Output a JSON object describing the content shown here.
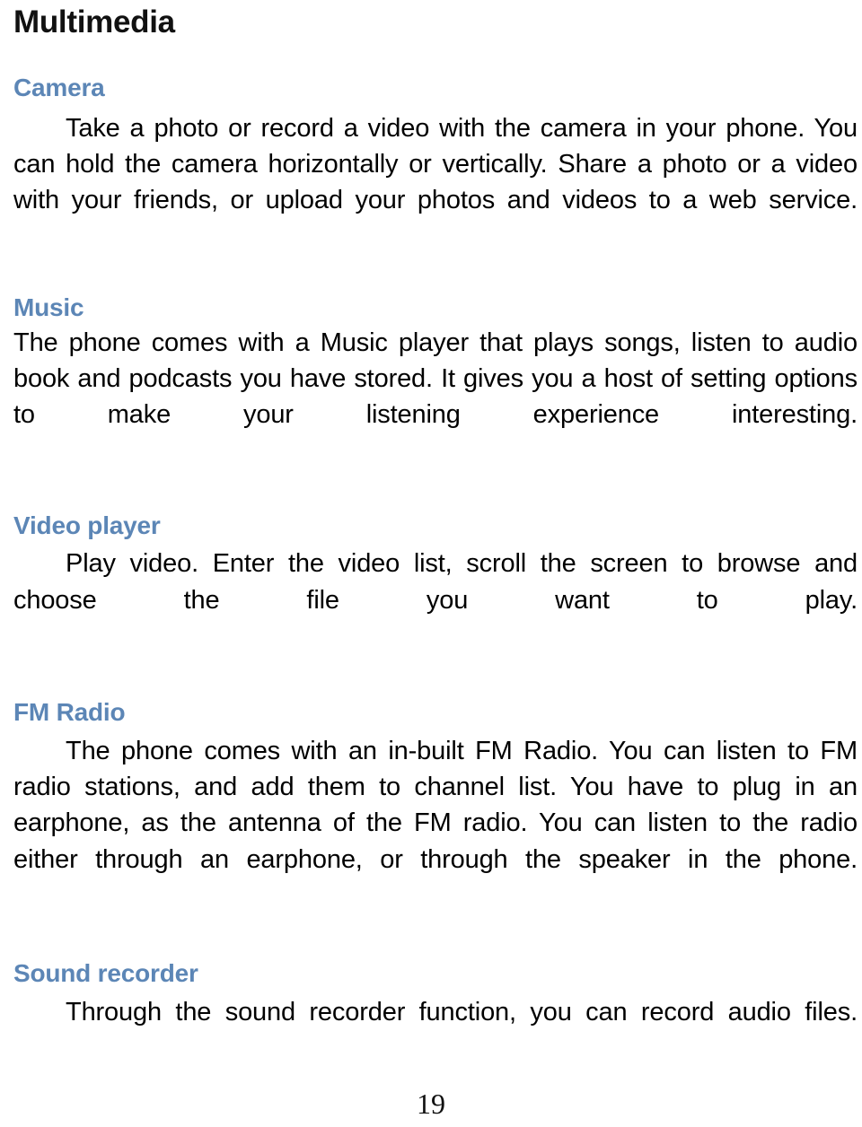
{
  "document": {
    "title": "Multimedia",
    "page_number": "19",
    "heading_color": "#5c86b6",
    "text_color": "#000000",
    "background_color": "#ffffff"
  },
  "sections": [
    {
      "heading": "Camera",
      "body": "Take a photo or record a video with the camera in your phone. You can hold the camera horizontally or vertically. Share a photo or a video with your friends, or upload your photos and videos to a web service."
    },
    {
      "heading": "Music",
      "body": "The phone comes with a Music player that plays songs, listen to audio book and podcasts you have stored. It gives you a host of setting options to make your listening experience interesting."
    },
    {
      "heading": "Video player",
      "body": "Play video. Enter the video list, scroll the screen to browse and choose the file you want to play."
    },
    {
      "heading": "FM Radio",
      "body": "The phone comes with an in-built FM Radio. You can listen to FM radio stations, and add them to channel list. You have to plug in an earphone, as the antenna of the FM radio. You can listen to the radio either through an earphone, or through the speaker in the phone."
    },
    {
      "heading": "Sound recorder",
      "body": "Through the sound recorder function, you can record audio files."
    }
  ]
}
